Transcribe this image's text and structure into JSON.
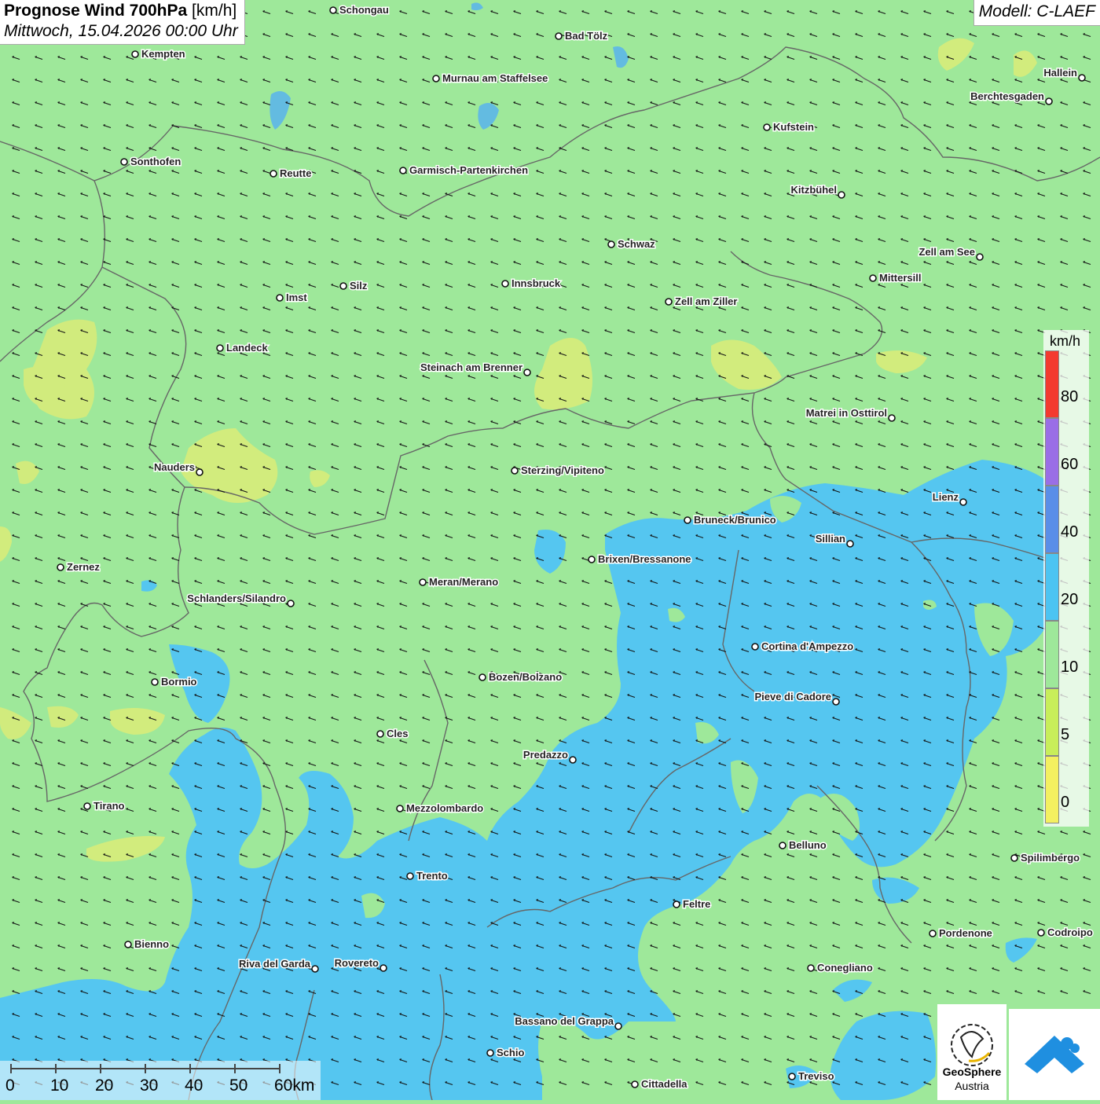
{
  "title": {
    "main": "Prognose Wind 700hPa",
    "unit": "[km/h]",
    "datetime": "Mittwoch, 15.04.2026 00:00 Uhr"
  },
  "model": "Modell: C-LAEF",
  "legend": {
    "unit": "km/h",
    "ticks": [
      "80",
      "60",
      "40",
      "20",
      "10",
      "5",
      "0"
    ],
    "colors": [
      "#f33a2f",
      "#9a6ee6",
      "#5a8ee8",
      "#4cc4f2",
      "#9ee89a",
      "#c8ee5a",
      "#f4f060"
    ]
  },
  "scalebar": {
    "labels": [
      "0",
      "10",
      "20",
      "30",
      "40",
      "50",
      "60km"
    ]
  },
  "logo": {
    "line1": "GeoSphere",
    "line2": "Austria"
  },
  "colors": {
    "land_green": "#9ee89a",
    "wind_blue": "#55c6f0",
    "calm_yellow": "#d7ec7a",
    "border": "#666666"
  },
  "cities": [
    {
      "name": "Schongau",
      "side": "right"
    },
    {
      "name": "Bad Tölz",
      "side": "right"
    },
    {
      "name": "Kempten",
      "side": "right"
    },
    {
      "name": "Murnau am Staffelsee",
      "side": "right"
    },
    {
      "name": "Hallein",
      "side": "left"
    },
    {
      "name": "Berchtesgaden",
      "side": "left"
    },
    {
      "name": "Kufstein",
      "side": "right"
    },
    {
      "name": "Sonthofen",
      "side": "right"
    },
    {
      "name": "Reutte",
      "side": "right"
    },
    {
      "name": "Garmisch-Partenkirchen",
      "side": "right"
    },
    {
      "name": "Kitzbühel",
      "side": "left"
    },
    {
      "name": "Schwaz",
      "side": "right"
    },
    {
      "name": "Zell am See",
      "side": "left"
    },
    {
      "name": "Mittersill",
      "side": "right"
    },
    {
      "name": "Silz",
      "side": "right"
    },
    {
      "name": "Innsbruck",
      "side": "right"
    },
    {
      "name": "Imst",
      "side": "right"
    },
    {
      "name": "Zell am Ziller",
      "side": "right"
    },
    {
      "name": "Landeck",
      "side": "right"
    },
    {
      "name": "Steinach am Brenner",
      "side": "left"
    },
    {
      "name": "Matrei in Osttirol",
      "side": "left"
    },
    {
      "name": "Nauders",
      "side": "left"
    },
    {
      "name": "Sterzing/Vipiteno",
      "side": "right"
    },
    {
      "name": "Lienz",
      "side": "left"
    },
    {
      "name": "Bruneck/Brunico",
      "side": "right"
    },
    {
      "name": "Sillian",
      "side": "left"
    },
    {
      "name": "Zernez",
      "side": "right"
    },
    {
      "name": "Brixen/Bressanone",
      "side": "right"
    },
    {
      "name": "Meran/Merano",
      "side": "right"
    },
    {
      "name": "Schlanders/Silandro",
      "side": "left"
    },
    {
      "name": "Cortina d'Ampezzo",
      "side": "right"
    },
    {
      "name": "Bozen/Bolzano",
      "side": "right"
    },
    {
      "name": "Bormio",
      "side": "right"
    },
    {
      "name": "Pieve di Cadore",
      "side": "left"
    },
    {
      "name": "Cles",
      "side": "right"
    },
    {
      "name": "Predazzo",
      "side": "left"
    },
    {
      "name": "Tirano",
      "side": "right"
    },
    {
      "name": "Mezzolombardo",
      "side": "right"
    },
    {
      "name": "Belluno",
      "side": "right"
    },
    {
      "name": "Spilimbergo",
      "side": "right"
    },
    {
      "name": "Trento",
      "side": "right"
    },
    {
      "name": "Feltre",
      "side": "right"
    },
    {
      "name": "Pordenone",
      "side": "right"
    },
    {
      "name": "Codroipo",
      "side": "right"
    },
    {
      "name": "Bienno",
      "side": "right"
    },
    {
      "name": "Riva del Garda",
      "side": "left"
    },
    {
      "name": "Rovereto",
      "side": "left"
    },
    {
      "name": "Conegliano",
      "side": "right"
    },
    {
      "name": "Bassano del Grappa",
      "side": "left"
    },
    {
      "name": "Schio",
      "side": "right"
    },
    {
      "name": "Treviso",
      "side": "right"
    },
    {
      "name": "Cittadella",
      "side": "right"
    }
  ]
}
